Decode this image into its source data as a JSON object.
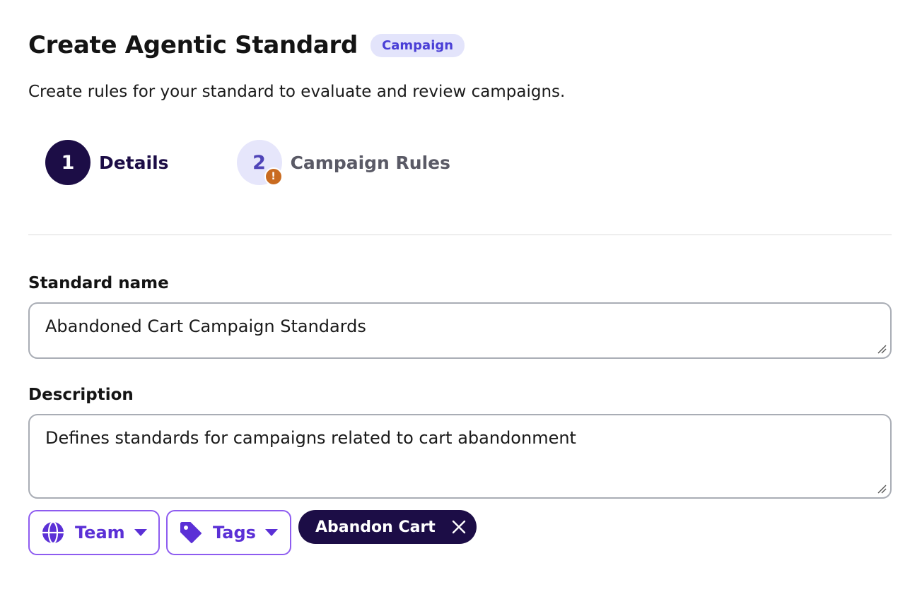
{
  "header": {
    "title": "Create Agentic Standard",
    "badge": "Campaign",
    "subtitle": "Create rules for your standard to evaluate and review campaigns."
  },
  "stepper": {
    "steps": [
      {
        "number": "1",
        "label": "Details",
        "state": "active"
      },
      {
        "number": "2",
        "label": "Campaign Rules",
        "state": "inactive",
        "warning": "!"
      }
    ]
  },
  "form": {
    "standard_name": {
      "label": "Standard name",
      "value": "Abandoned Cart Campaign Standards"
    },
    "description": {
      "label": "Description",
      "value": "Defines standards for campaigns related to cart abandonment"
    }
  },
  "controls": {
    "team": {
      "label": "Team",
      "icon": "globe-icon"
    },
    "tags": {
      "label": "Tags",
      "icon": "tag-icon"
    },
    "selected_tags": [
      {
        "label": "Abandon Cart"
      }
    ]
  },
  "colors": {
    "brand_dark": "#1c0d46",
    "accent_purple": "#5b30d6",
    "badge_bg": "#e3e4fb",
    "warning": "#c96b20"
  }
}
